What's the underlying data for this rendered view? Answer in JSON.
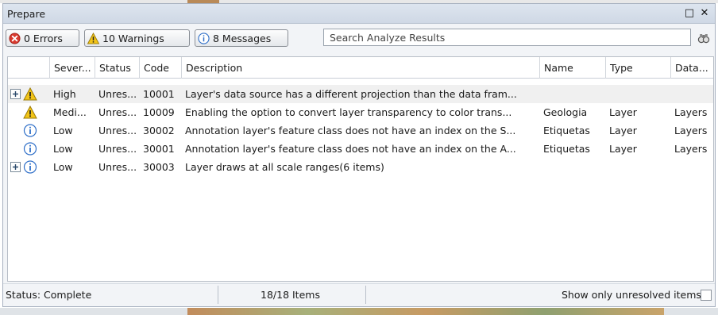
{
  "window": {
    "title": "Prepare",
    "maximize_label": "□",
    "close_label": "✕"
  },
  "toolbar": {
    "errors_label": "0 Errors",
    "warnings_label": "10 Warnings",
    "messages_label": "8 Messages",
    "search_placeholder": "Search Analyze Results",
    "search_icon": "binoculars-icon"
  },
  "table": {
    "columns": [
      "Sever...",
      "Status",
      "Code",
      "Description",
      "Name",
      "Type",
      "Data..."
    ],
    "rows": [
      {
        "expand": true,
        "icon": "warning-icon",
        "severity": "High",
        "status": "Unres...",
        "code": "10001",
        "description": "Layer's data source has a different projection than the data fram...",
        "name": "",
        "type": "",
        "data": ""
      },
      {
        "expand": false,
        "icon": "warning-icon",
        "severity": "Medi...",
        "status": "Unres...",
        "code": "10009",
        "description": "Enabling the option to convert layer transparency to color trans...",
        "name": "Geologia",
        "type": "Layer",
        "data": "Layers"
      },
      {
        "expand": false,
        "icon": "info-icon",
        "severity": "Low",
        "status": "Unres...",
        "code": "30002",
        "description": "Annotation layer's feature class does not have an index on the S...",
        "name": "Etiquetas",
        "type": "Layer",
        "data": "Layers"
      },
      {
        "expand": false,
        "icon": "info-icon",
        "severity": "Low",
        "status": "Unres...",
        "code": "30001",
        "description": "Annotation layer's feature class does not have an index on the A...",
        "name": "Etiquetas",
        "type": "Layer",
        "data": "Layers"
      },
      {
        "expand": true,
        "icon": "info-icon",
        "severity": "Low",
        "status": "Unres...",
        "code": "30003",
        "description": "Layer draws at all scale ranges(6 items)",
        "name": "",
        "type": "",
        "data": ""
      }
    ]
  },
  "status": {
    "text": "Status: Complete",
    "items": "18/18 Items",
    "unresolved_label": "Show only unresolved items",
    "unresolved_checked": false
  },
  "colors": {
    "error": "#d93a2f",
    "warning": "#f2c417",
    "info": "#2f6fc8"
  }
}
